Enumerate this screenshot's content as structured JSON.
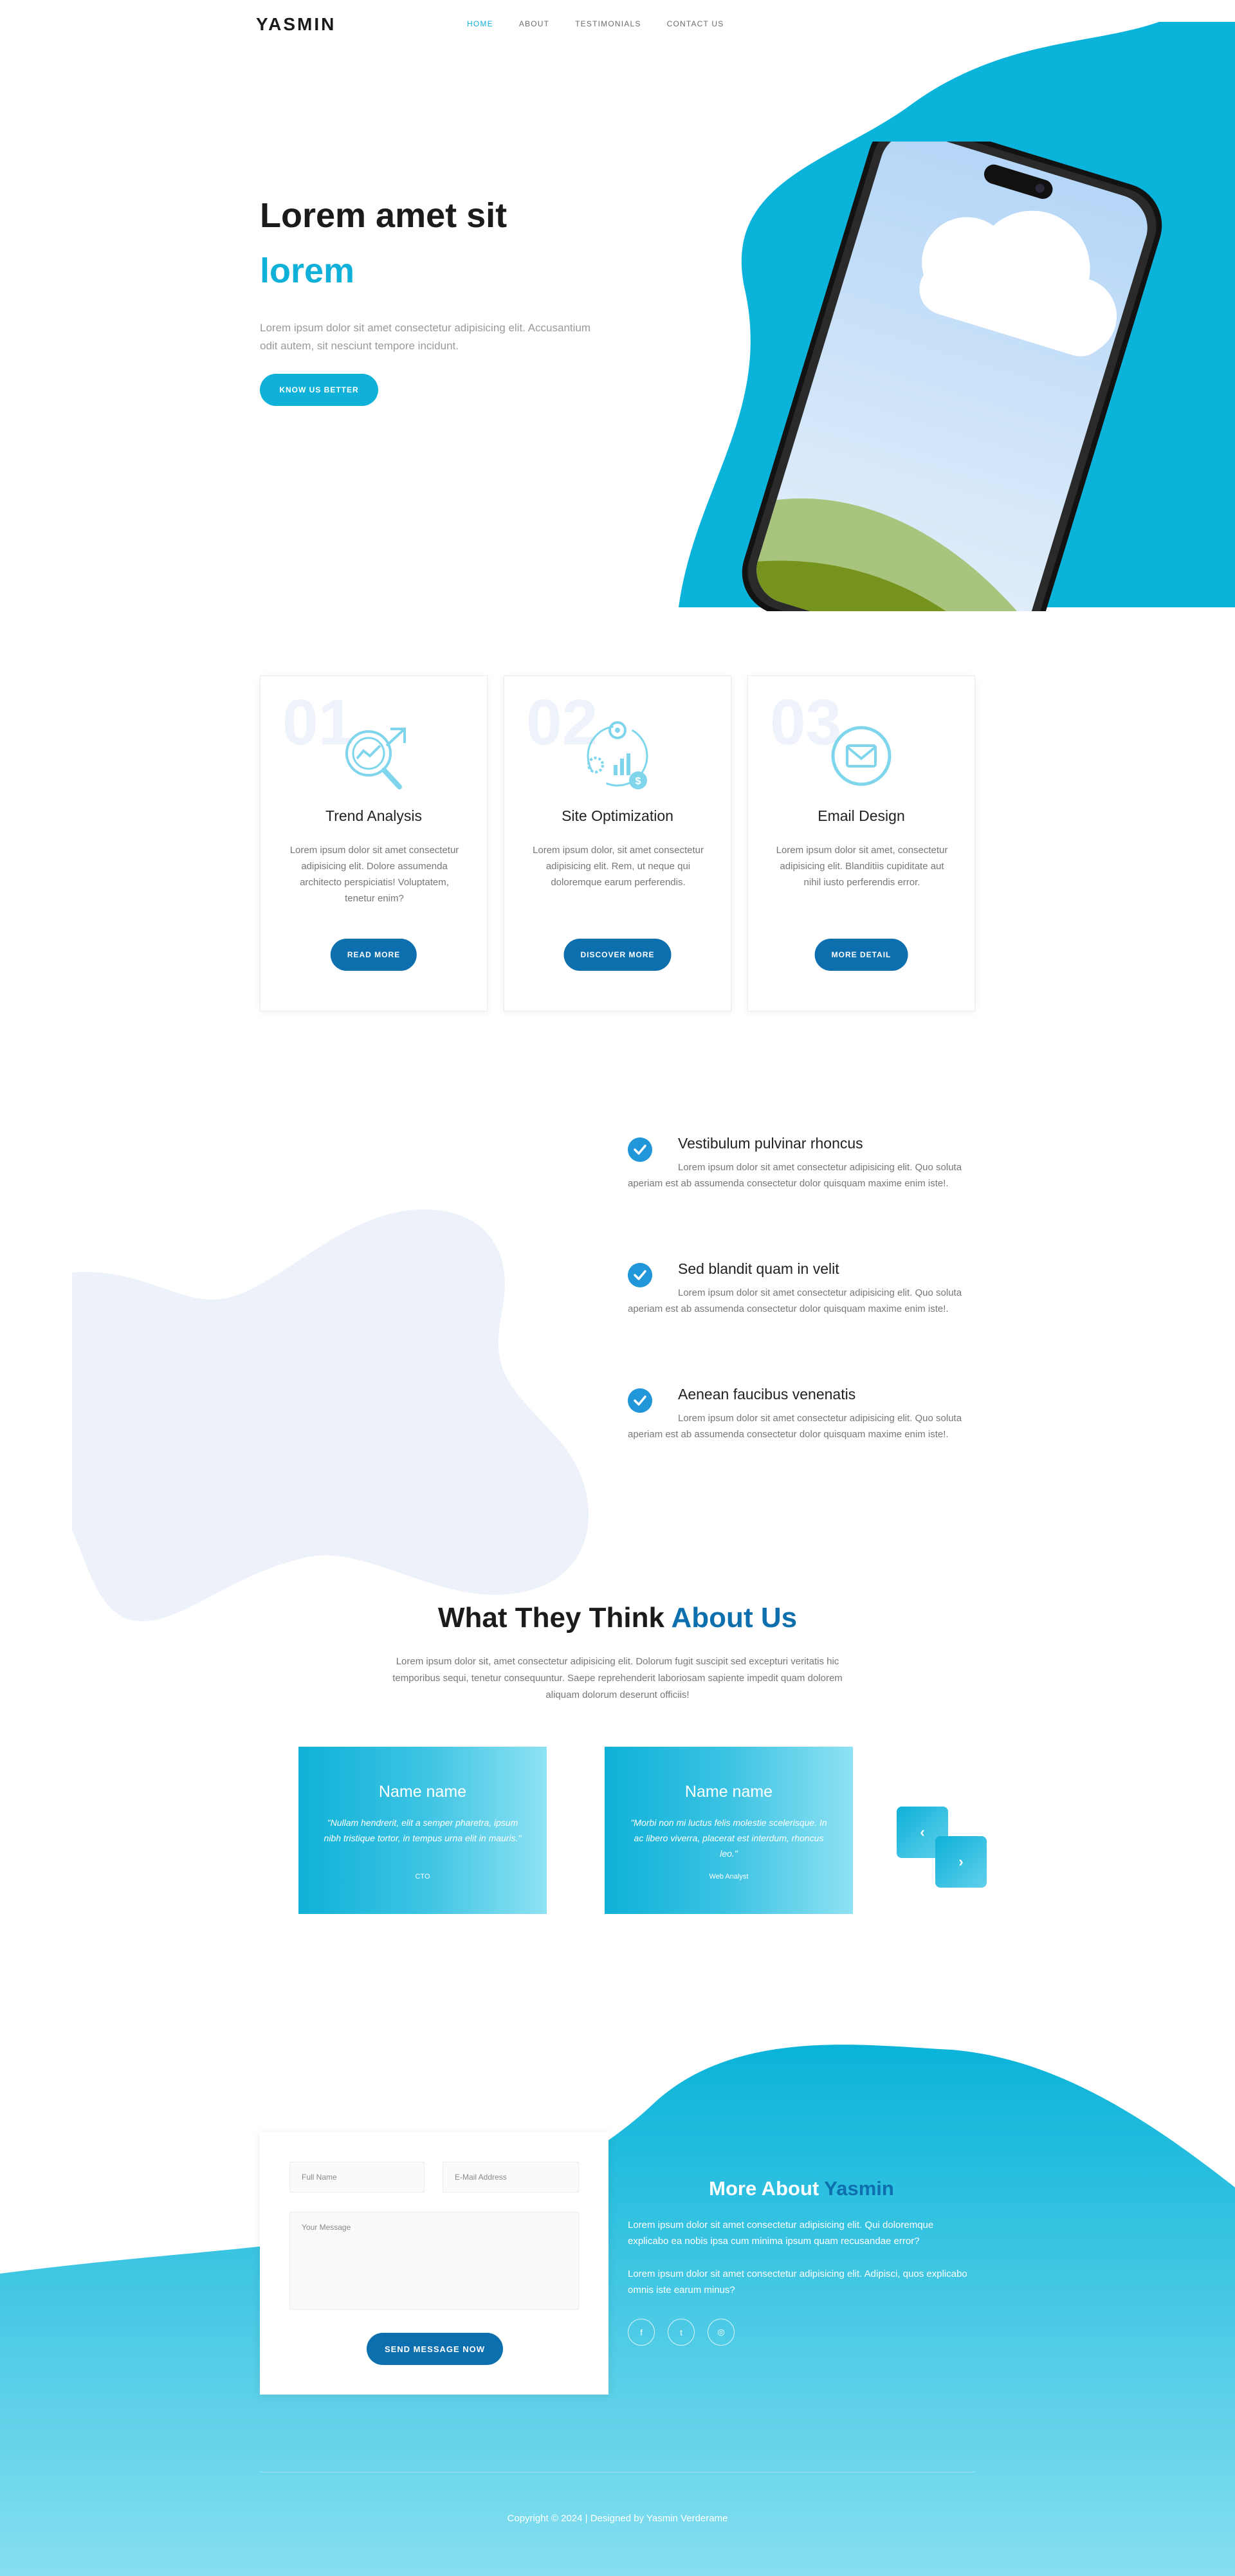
{
  "nav": {
    "logo": "YASMIN",
    "items": [
      {
        "label": "HOME",
        "active": true
      },
      {
        "label": "ABOUT",
        "active": false
      },
      {
        "label": "TESTIMONIALS",
        "active": false
      },
      {
        "label": "CONTACT US",
        "active": false
      }
    ]
  },
  "hero": {
    "title": "Lorem amet sit",
    "subtitle": "lorem",
    "text": "Lorem ipsum dolor sit amet consectetur adipisicing elit. Accusantium odit autem, sit nesciunt tempore incidunt.",
    "button": "KNOW US BETTER"
  },
  "services": [
    {
      "number": "01",
      "icon": "trend-analysis-icon",
      "title": "Trend Analysis",
      "text": "Lorem ipsum dolor sit amet consectetur adipisicing elit. Dolore assumenda architecto perspiciatis! Voluptatem, tenetur enim?",
      "button": "READ MORE"
    },
    {
      "number": "02",
      "icon": "site-optimization-icon",
      "title": "Site Optimization",
      "text": "Lorem ipsum dolor, sit amet consectetur adipisicing elit. Rem, ut neque qui doloremque earum perferendis.",
      "button": "DISCOVER MORE"
    },
    {
      "number": "03",
      "icon": "email-design-icon",
      "title": "Email Design",
      "text": "Lorem ipsum dolor sit amet, consectetur adipisicing elit. Blanditiis cupiditate aut nihil iusto perferendis error.",
      "button": "MORE DETAIL"
    }
  ],
  "features": [
    {
      "title": "Vestibulum pulvinar rhoncus",
      "text": "Lorem ipsum dolor sit amet consectetur adipisicing elit. Quo soluta aperiam est ab assumenda consectetur dolor quisquam maxime enim iste!."
    },
    {
      "title": "Sed blandit quam in velit",
      "text": "Lorem ipsum dolor sit amet consectetur adipisicing elit. Quo soluta aperiam est ab assumenda consectetur dolor quisquam maxime enim iste!."
    },
    {
      "title": "Aenean faucibus venenatis",
      "text": "Lorem ipsum dolor sit amet consectetur adipisicing elit. Quo soluta aperiam est ab assumenda consectetur dolor quisquam maxime enim iste!."
    }
  ],
  "testimonials": {
    "heading": "What They Think",
    "heading_accent": "About Us",
    "text": "Lorem ipsum dolor sit, amet consectetur adipisicing elit. Dolorum fugit suscipit sed excepturi veritatis hic temporibus sequi, tenetur consequuntur. Saepe reprehenderit laboriosam sapiente impedit quam dolorem aliquam dolorum deserunt officiis!",
    "items": [
      {
        "name": "Name name",
        "quote": "\"Nullam hendrerit, elit a semper pharetra, ipsum nibh tristique tortor, in tempus urna elit in mauris.\"",
        "role": "CTO"
      },
      {
        "name": "Name name",
        "quote": "\"Morbi non mi luctus felis molestie scelerisque. In ac libero viverra, placerat est interdum, rhoncus leo.\"",
        "role": "Web Analyst"
      }
    ],
    "prev": "‹",
    "next": "›"
  },
  "contact": {
    "full_name_placeholder": "Full Name",
    "email_placeholder": "E-Mail Address",
    "message_placeholder": "Your Message",
    "button": "SEND MESSAGE NOW"
  },
  "about": {
    "heading": "More About",
    "heading_accent": "Yasmin",
    "p1": "Lorem ipsum dolor sit amet consectetur adipisicing elit. Qui doloremque explicabo ea nobis ipsa cum minima ipsum quam recusandae error?",
    "p2": "Lorem ipsum dolor sit amet consectetur adipisicing elit. Adipisci, quos explicabo omnis iste earum minus?",
    "social": [
      {
        "icon": "facebook-icon",
        "glyph": "f"
      },
      {
        "icon": "twitter-icon",
        "glyph": "t"
      },
      {
        "icon": "instagram-icon",
        "glyph": "◎"
      }
    ]
  },
  "footer": {
    "copyright": "Copyright © 2024 | Designed by Yasmin Verderame"
  },
  "colors": {
    "primary": "#0fb1d8",
    "dark_blue": "#0d6fad",
    "check_blue": "#2196d8",
    "blob_light": "#edf2fa"
  }
}
